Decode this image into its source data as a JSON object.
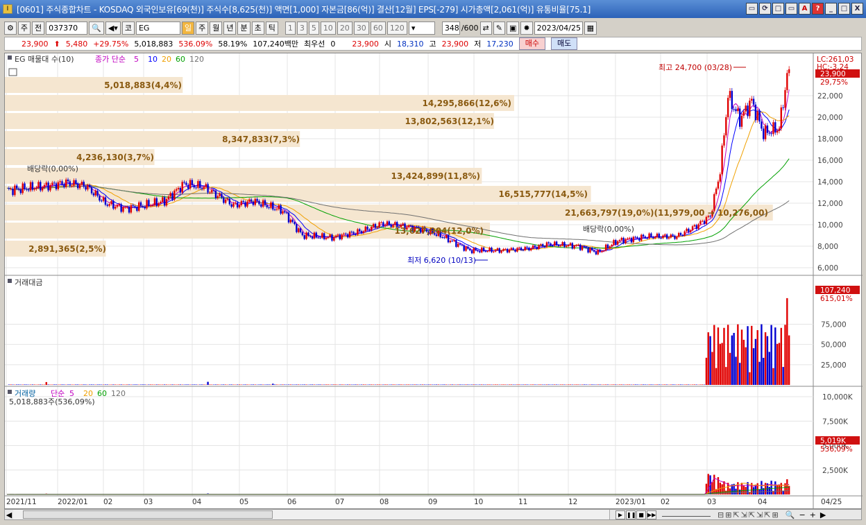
{
  "window": {
    "title": "[0601] 주식종합차트 - KOSDAQ 외국인보유[69(천)] 주식수[8,625(천)] 액면[1,000] 자본금[86(억)] 결산[12월] EPS[-279] 시가총액[2,061(억)] 유통비율[75.1]",
    "buttons": [
      "▭",
      "⟳",
      "□",
      "▭",
      "A",
      "?",
      "_",
      "□",
      "X"
    ]
  },
  "toolbar": {
    "period": "주",
    "prev": "전",
    "code": "037370",
    "market": "코",
    "name": "EG",
    "intervals": [
      "일",
      "주",
      "월",
      "년",
      "분",
      "초",
      "틱"
    ],
    "minutes": [
      "1",
      "3",
      "5",
      "10",
      "20",
      "30",
      "60",
      "120"
    ],
    "count": "348",
    "count_total": "/600",
    "date": "2023/04/25"
  },
  "quote": {
    "price": "23,900",
    "change": "5,480",
    "change_pct": "+29.75%",
    "volume": "5,018,883",
    "vol_ratio": "536.09%",
    "turnover": "58.19%",
    "amount": "107,240백만",
    "best_label": "최우선",
    "best_val": "0",
    "ask": "23,900",
    "open_label": "시",
    "open": "18,310",
    "high_label": "고",
    "high": "23,900",
    "low_label": "저",
    "low": "17,230",
    "buy": "매수",
    "sell": "매도"
  },
  "panel1": {
    "legend_title": "EG 매물대 수(10)",
    "ma_label": "종가 단순",
    "ma_periods": [
      "5",
      "10",
      "20",
      "60",
      "120"
    ],
    "ma_colors": [
      "#c000c0",
      "#0000ff",
      "#f0a000",
      "#00a000",
      "#707070"
    ],
    "volume_profile": [
      {
        "label": "5,018,883(4,4%)",
        "frac": 0.044
      },
      {
        "label": "14,295,866(12,6%)",
        "frac": 0.126
      },
      {
        "label": "13,802,563(12,1%)",
        "frac": 0.121
      },
      {
        "label": "8,347,833(7,3%)",
        "frac": 0.073
      },
      {
        "label": "4,236,130(3,7%)",
        "frac": 0.037
      },
      {
        "label": "13,424,899(11,8%)",
        "frac": 0.118
      },
      {
        "label": "16,515,777(14,5%)",
        "frac": 0.145
      },
      {
        "label": "21,663,797(19,0%)(11,979,00 → 10,276,00)",
        "frac": 0.19
      },
      {
        "label": "13,627,904(12,0%)",
        "frac": 0.12
      },
      {
        "label": "2,891,365(2,5%)",
        "frac": 0.025
      }
    ],
    "high_note": "최고 24,700 (03/28)",
    "low_note": "최저 6,620 (10/13)",
    "div1": "배당락(0,00%)",
    "div2": "배당락(0,00%)",
    "lc": "LC:261,03",
    "hc": "HC:-3,24",
    "price_tag": "23,900",
    "price_pct": "29,75%",
    "yticks": [
      "22,000",
      "20,000",
      "18,000",
      "16,000",
      "14,000",
      "12,000",
      "10,000",
      "8,000",
      "6,000"
    ]
  },
  "panel2": {
    "legend_title": "거래대금",
    "tag": "107,240",
    "tag_pct": "615,01%",
    "yticks": [
      "75,000",
      "50,000",
      "25,000"
    ]
  },
  "panel3": {
    "legend_title": "거래량",
    "ma_label": "단순",
    "ma_periods": [
      "5",
      "20",
      "60",
      "120"
    ],
    "sub": "5,018,883주(536,09%)",
    "tag": "5,019K",
    "tag_pct": "536,09%",
    "yticks": [
      "10,000K",
      "7,500K",
      "5,000K",
      "2,500K"
    ]
  },
  "xaxis": {
    "labels": [
      "2021/11",
      "2022/01",
      "02",
      "03",
      "04",
      "05",
      "06",
      "07",
      "08",
      "09",
      "10",
      "11",
      "12",
      "2023/01",
      "02",
      "03",
      "04",
      "04/25"
    ]
  },
  "colors": {
    "up": "#e00000",
    "down": "#0000d0",
    "vp_fill": "#f5e6d0",
    "title_bg": "#3a74c8"
  }
}
